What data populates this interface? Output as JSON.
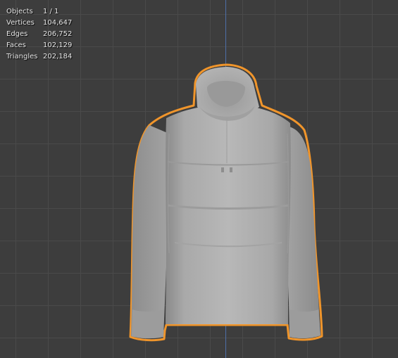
{
  "viewport": {
    "axis_color": "#4e6fa8",
    "grid_color": "#4a4a4a",
    "background_color": "#3d3d3d",
    "selection_outline_color": "#f0952b"
  },
  "stats": [
    {
      "label": "Objects",
      "value": "1 / 1"
    },
    {
      "label": "Vertices",
      "value": "104,647"
    },
    {
      "label": "Edges",
      "value": "206,752"
    },
    {
      "label": "Faces",
      "value": "102,129"
    },
    {
      "label": "Triangles",
      "value": "202,184"
    }
  ],
  "object": {
    "icon": "hoodie-mesh",
    "selected": true
  }
}
